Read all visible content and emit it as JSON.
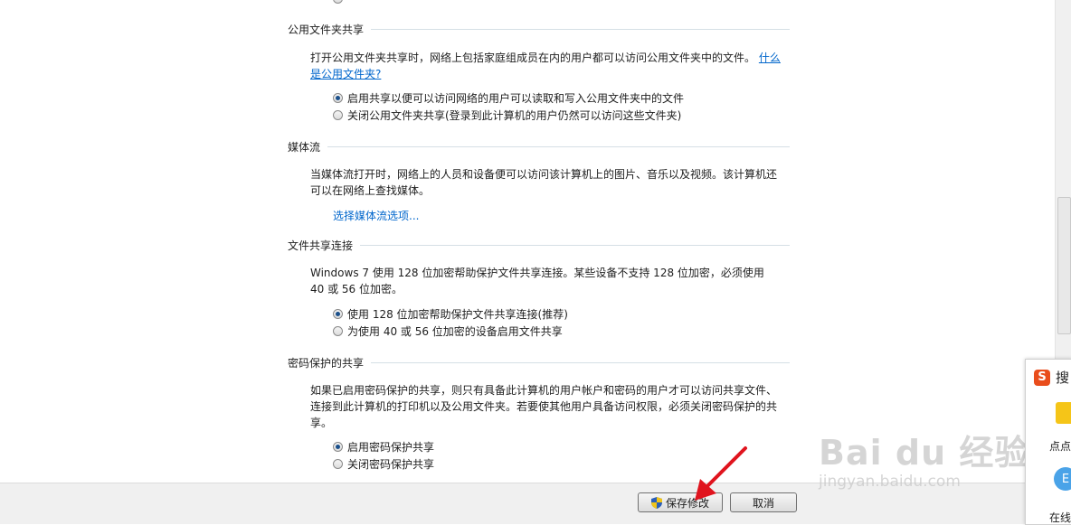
{
  "sections": {
    "public_folder": {
      "title": "公用文件夹共享",
      "desc": "打开公用文件夹共享时，网络上包括家庭组成员在内的用户都可以访问公用文件夹中的文件。",
      "link": "什么是公用文件夹?",
      "options": [
        "启用共享以便可以访问网络的用户可以读取和写入公用文件夹中的文件",
        "关闭公用文件夹共享(登录到此计算机的用户仍然可以访问这些文件夹)"
      ]
    },
    "media": {
      "title": "媒体流",
      "desc": "当媒体流打开时，网络上的人员和设备便可以访问该计算机上的图片、音乐以及视频。该计算机还可以在网络上查找媒体。",
      "link": "选择媒体流选项..."
    },
    "file_sharing": {
      "title": "文件共享连接",
      "desc": "Windows 7 使用 128 位加密帮助保护文件共享连接。某些设备不支持 128 位加密，必须使用 40 或 56 位加密。",
      "options": [
        "使用 128 位加密帮助保护文件共享连接(推荐)",
        "为使用 40 或 56 位加密的设备启用文件共享"
      ]
    },
    "password": {
      "title": "密码保护的共享",
      "desc": "如果已启用密码保护的共享，则只有具备此计算机的用户帐户和密码的用户才可以访问共享文件、连接到此计算机的打印机以及公用文件夹。若要使其他用户具备访问权限，必须关闭密码保护的共享。",
      "options": [
        "启用密码保护共享",
        "关闭密码保护共享"
      ]
    }
  },
  "buttons": {
    "save": "保存修改",
    "cancel": "取消"
  },
  "side_panel": {
    "search_label": "搜",
    "item1": "点点",
    "item2": "在线"
  },
  "watermark": {
    "main": "Bai du 经验",
    "url": "jingyan.baidu.com"
  },
  "colors": {
    "link": "#0066cc",
    "arrow": "#e0141e",
    "sogou": "#e94d1c"
  }
}
